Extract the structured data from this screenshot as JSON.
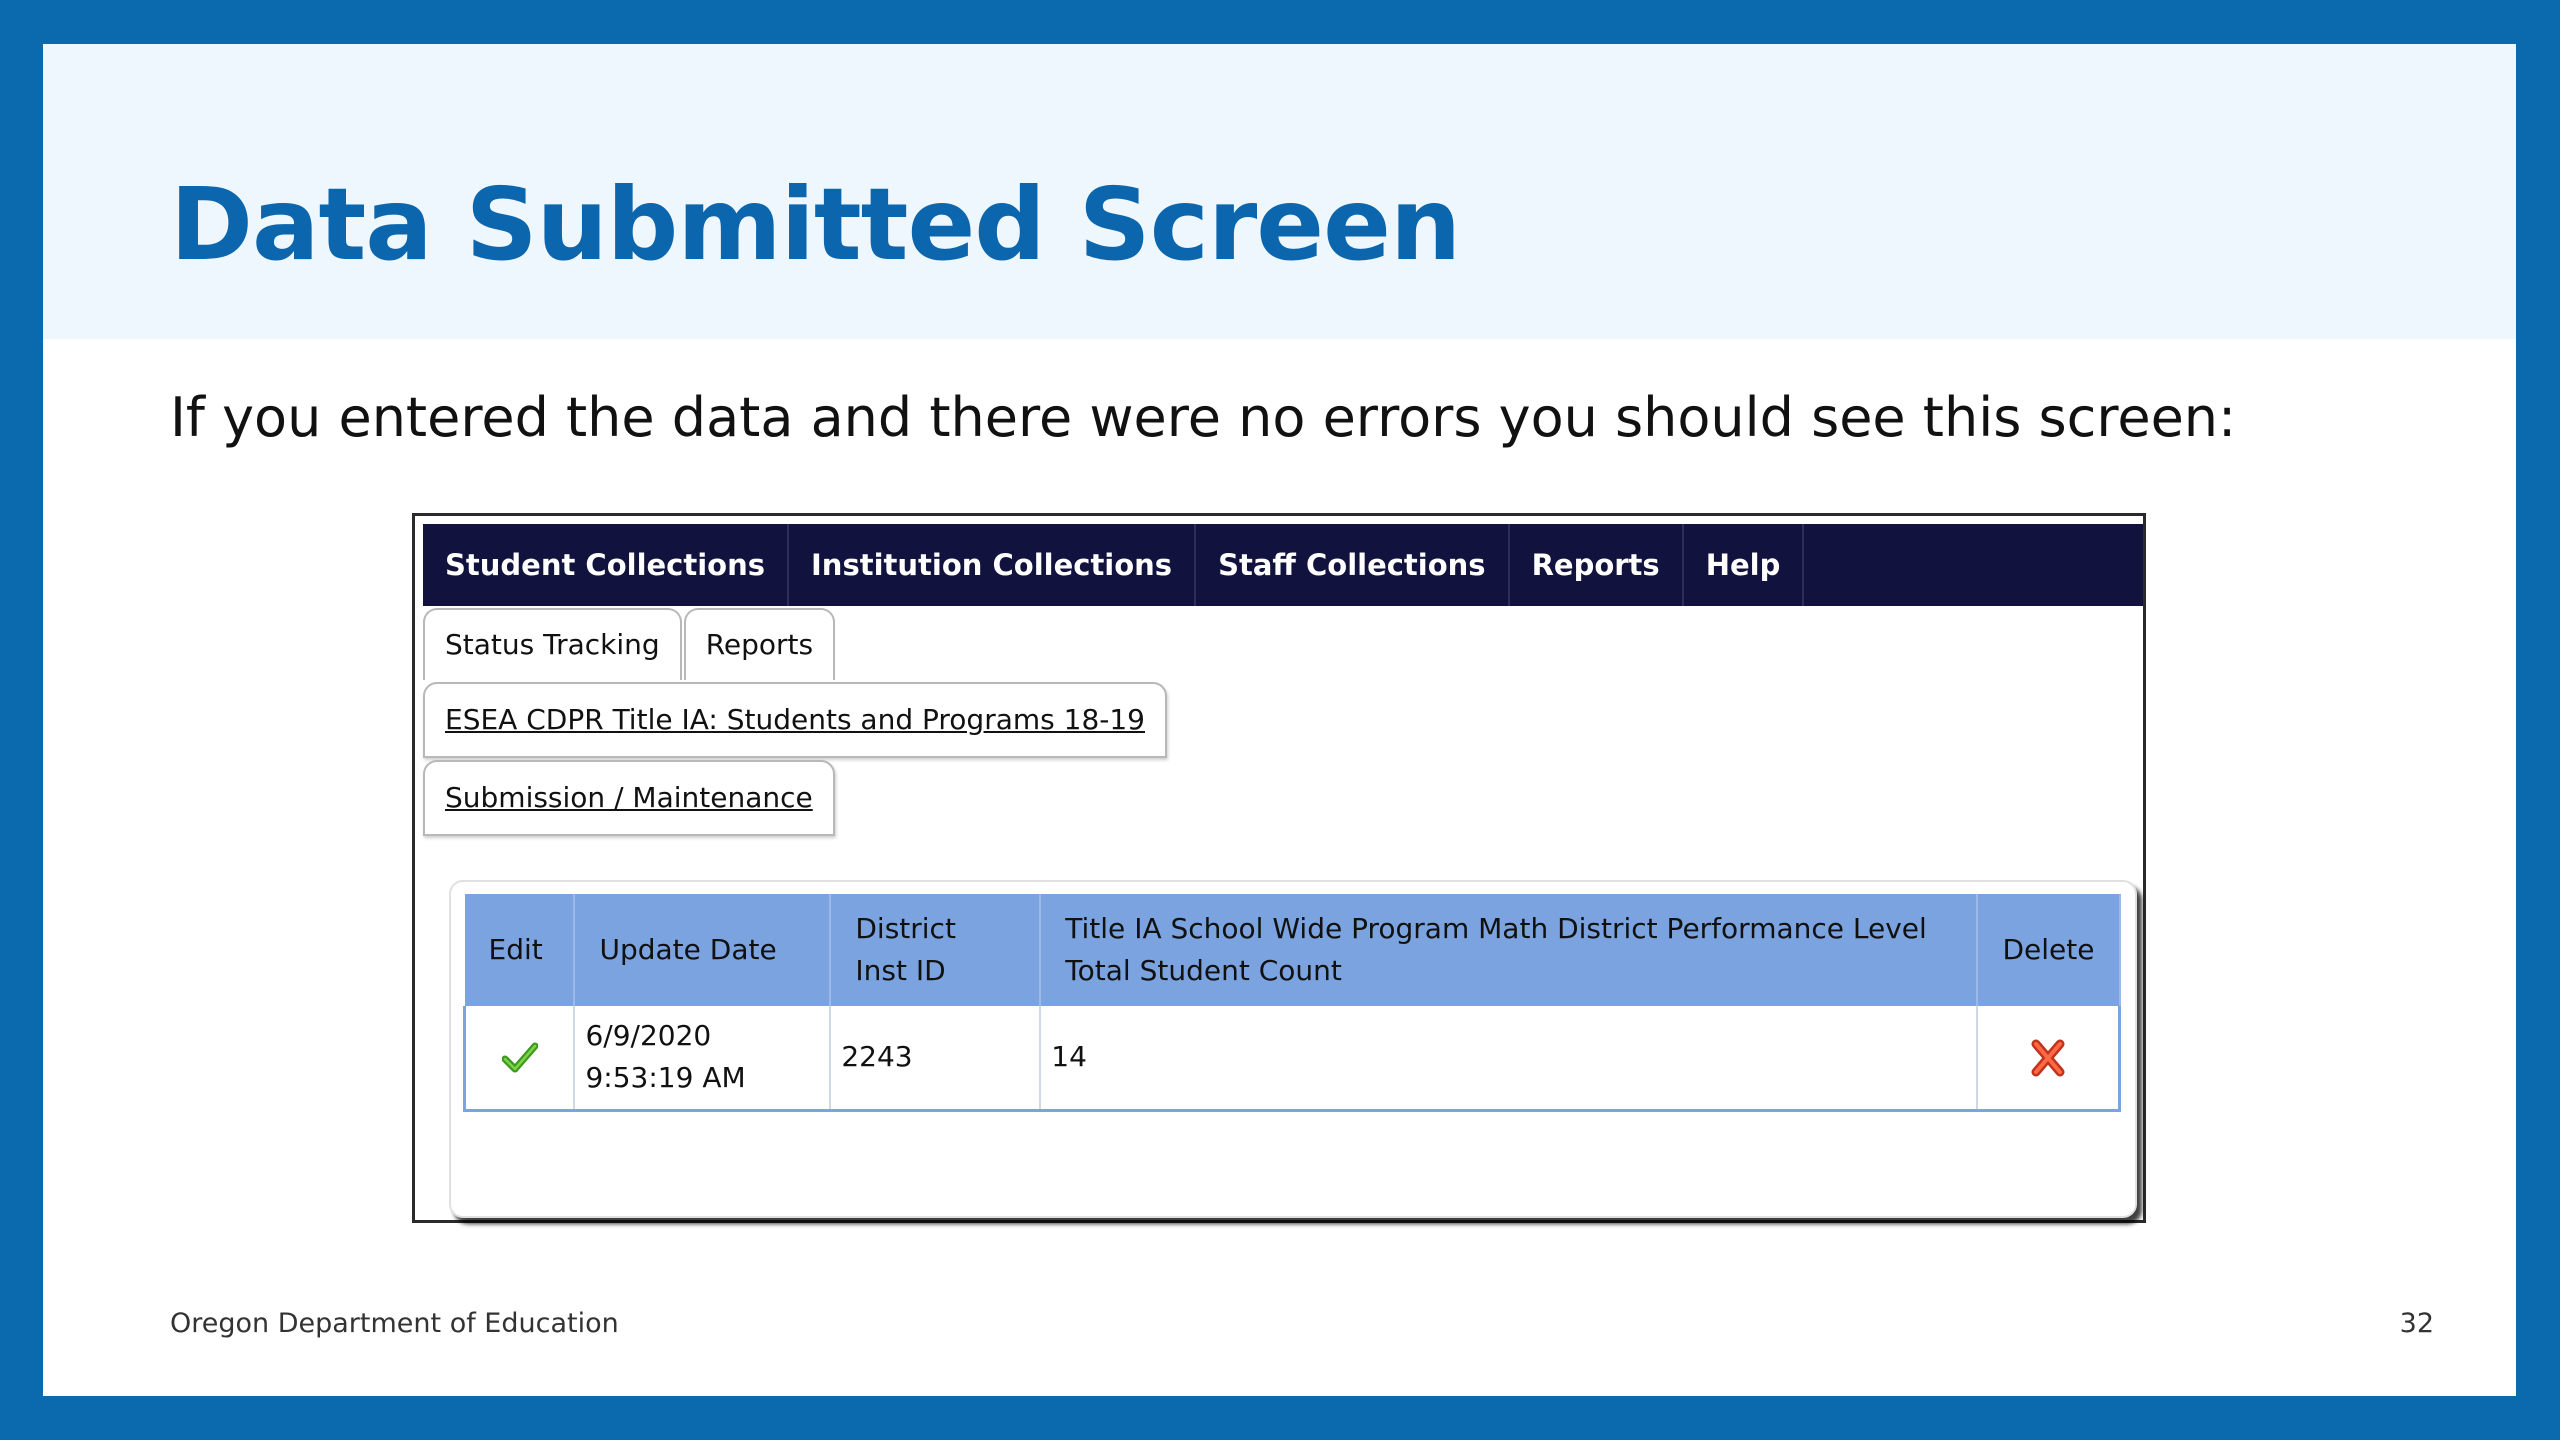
{
  "slide": {
    "title": "Data Submitted Screen",
    "subtitle": "If you entered the data and there were no errors you should see this screen:",
    "footer_org": "Oregon Department of Education",
    "page_number": "32"
  },
  "colors": {
    "frame": "#0a6aad",
    "title": "#0b66ad",
    "navbar": "#12123e",
    "table_header": "#7ba3e0",
    "check": "#3c9a1e",
    "delete": "#e0452a"
  },
  "app": {
    "nav": [
      "Student Collections",
      "Institution Collections",
      "Staff Collections",
      "Reports",
      "Help"
    ],
    "tabs": [
      "Status Tracking",
      "Reports"
    ],
    "breadcrumb_collection": "ESEA CDPR Title IA: Students and Programs 18-19",
    "breadcrumb_page": "Submission / Maintenance",
    "table": {
      "headers": {
        "edit": "Edit",
        "update_date": "Update Date",
        "district_inst_id": "District Inst ID",
        "count": "Title IA School Wide Program Math District Performance Level Total Student Count",
        "delete": "Delete"
      },
      "rows": [
        {
          "edit_icon": "checkmark-icon",
          "update_date": "6/9/2020 9:53:19 AM",
          "district_inst_id": "2243",
          "count": "14",
          "delete_icon": "delete-x-icon"
        }
      ]
    }
  }
}
